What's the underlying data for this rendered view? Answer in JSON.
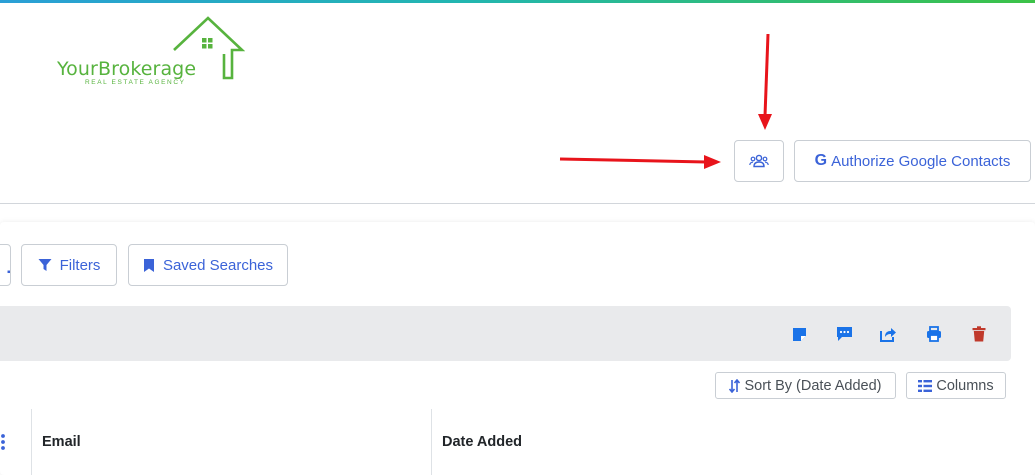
{
  "brand": {
    "name": "YourBrokerage",
    "tagline": "REAL ESTATE AGENCY",
    "color": "#57b33e"
  },
  "header": {
    "google_button_label": "Authorize Google Contacts",
    "google_icon": "G",
    "contacts_icon": "users-icon"
  },
  "toolbar": {
    "filters_label": "Filters",
    "saved_searches_label": "Saved Searches"
  },
  "actions": [
    {
      "name": "note-icon",
      "color": "#1a73e8"
    },
    {
      "name": "message-icon",
      "color": "#1a73e8"
    },
    {
      "name": "share-icon",
      "color": "#1a73e8"
    },
    {
      "name": "print-icon",
      "color": "#1a73e8"
    },
    {
      "name": "trash-icon",
      "color": "#c0392b"
    }
  ],
  "table_controls": {
    "sort_label": "Sort By (Date Added)",
    "columns_label": "Columns"
  },
  "table": {
    "columns": [
      "Email",
      "Date Added"
    ]
  },
  "annotations": {
    "arrow_color": "#e8141b"
  }
}
